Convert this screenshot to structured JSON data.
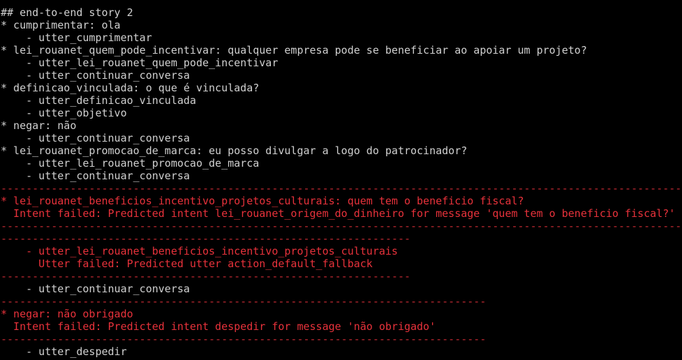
{
  "terminal": {
    "lines": [
      {
        "text": "## end-to-end story 2",
        "style": "normal"
      },
      {
        "text": "* cumprimentar: ola",
        "style": "normal"
      },
      {
        "text": "    - utter_cumprimentar",
        "style": "normal"
      },
      {
        "text": "* lei_rouanet_quem_pode_incentivar: qualquer empresa pode se beneficiar ao apoiar um projeto?",
        "style": "normal"
      },
      {
        "text": "    - utter_lei_rouanet_quem_pode_incentivar",
        "style": "normal"
      },
      {
        "text": "    - utter_continuar_conversa",
        "style": "normal"
      },
      {
        "text": "* definicao_vinculada: o que é vinculada?",
        "style": "normal"
      },
      {
        "text": "    - utter_definicao_vinculada",
        "style": "normal"
      },
      {
        "text": "    - utter_objetivo",
        "style": "normal"
      },
      {
        "text": "* negar: não",
        "style": "normal"
      },
      {
        "text": "    - utter_continuar_conversa",
        "style": "normal"
      },
      {
        "text": "* lei_rouanet_promocao_de_marca: eu posso divulgar a logo do patrocinador?",
        "style": "normal"
      },
      {
        "text": "    - utter_lei_rouanet_promocao_de_marca",
        "style": "normal"
      },
      {
        "text": "    - utter_continuar_conversa",
        "style": "normal"
      },
      {
        "text": "------------------------------------------------------------------------------------------------------------------------",
        "style": "sep"
      },
      {
        "text": "* lei_rouanet_beneficios_incentivo_projetos_culturais: quem tem o beneficio fiscal?",
        "style": "err"
      },
      {
        "text": "  Intent failed: Predicted intent lei_rouanet_origem_do_dinheiro for message 'quem tem o beneficio fiscal?'",
        "style": "err"
      },
      {
        "text": "------------------------------------------------------------------------------------------------------------------------",
        "style": "sep"
      },
      {
        "text": "-----------------------------------------------------------------",
        "style": "sep"
      },
      {
        "text": "    - utter_lei_rouanet_beneficios_incentivo_projetos_culturais",
        "style": "err"
      },
      {
        "text": "      Utter failed: Predicted utter action_default_fallback",
        "style": "err"
      },
      {
        "text": "-----------------------------------------------------------------",
        "style": "sep"
      },
      {
        "text": "    - utter_continuar_conversa",
        "style": "normal"
      },
      {
        "text": "-----------------------------------------------------------------------------",
        "style": "sep"
      },
      {
        "text": "* negar: não obrigado",
        "style": "err"
      },
      {
        "text": "  Intent failed: Predicted intent despedir for message 'não obrigado'",
        "style": "err"
      },
      {
        "text": "-----------------------------------------------------------------------------",
        "style": "sep"
      },
      {
        "text": "    - utter_despedir",
        "style": "normal"
      }
    ]
  },
  "colors": {
    "background": "#000000",
    "foreground": "#d0d0d0",
    "error": "#e8323b"
  }
}
